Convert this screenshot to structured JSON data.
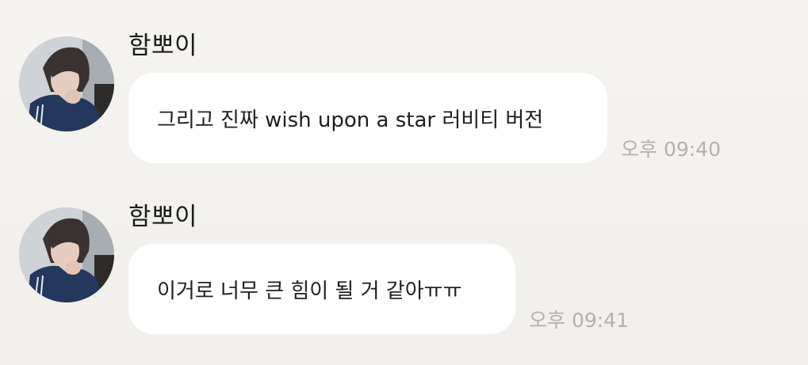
{
  "messages": [
    {
      "sender": "함뽀이",
      "text": "그리고 진짜 wish upon a star 러비티 버전",
      "time": "오후 09:40"
    },
    {
      "sender": "함뽀이",
      "text": "이거로 너무 큰 힘이 될 거 같아ㅠㅠ",
      "time": "오후 09:41"
    }
  ],
  "colors": {
    "background": "#f5f3ef",
    "bubble": "#ffffff",
    "text": "#1e1e1e",
    "timestamp": "#b4b2ae"
  }
}
